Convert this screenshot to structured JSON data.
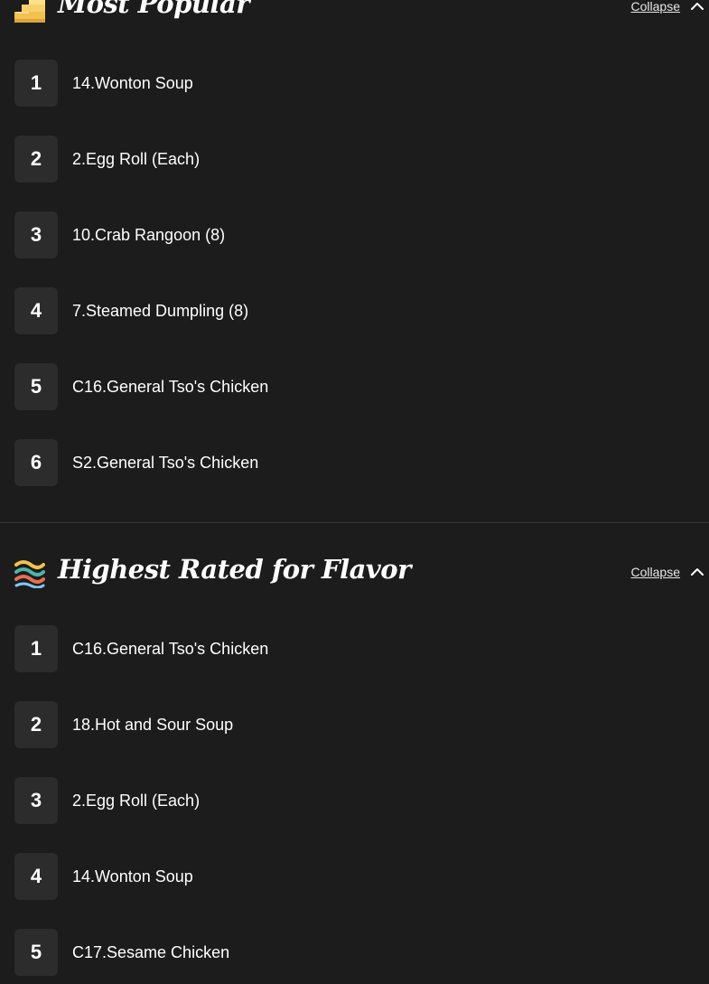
{
  "sections": [
    {
      "title": "Most Popular",
      "icon": "stairs-icon",
      "collapse_label": "Collapse",
      "items": [
        {
          "rank": "1",
          "name": "14.Wonton Soup"
        },
        {
          "rank": "2",
          "name": "2.Egg Roll (Each)"
        },
        {
          "rank": "3",
          "name": "10.Crab Rangoon (8)"
        },
        {
          "rank": "4",
          "name": "7.Steamed Dumpling (8)"
        },
        {
          "rank": "5",
          "name": "C16.General Tso's Chicken"
        },
        {
          "rank": "6",
          "name": "S2.General Tso's Chicken"
        }
      ]
    },
    {
      "title": "Highest Rated for Flavor",
      "icon": "flavor-lines-icon",
      "collapse_label": "Collapse",
      "items": [
        {
          "rank": "1",
          "name": "C16.General Tso's Chicken"
        },
        {
          "rank": "2",
          "name": "18.Hot and Sour Soup"
        },
        {
          "rank": "3",
          "name": "2.Egg Roll (Each)"
        },
        {
          "rank": "4",
          "name": "14.Wonton Soup"
        },
        {
          "rank": "5",
          "name": "C17.Sesame Chicken"
        }
      ]
    }
  ],
  "colors": {
    "background": "#1c1c1c",
    "rank_tile": "#2c2c2c",
    "divider": "#3a3a3a",
    "text": "#ffffff"
  }
}
